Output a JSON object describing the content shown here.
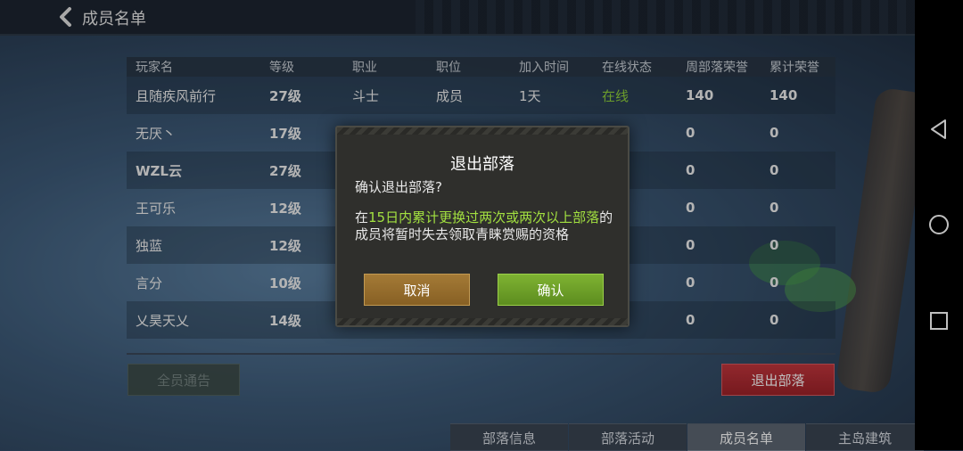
{
  "header": {
    "title": "成员名单"
  },
  "table": {
    "columns": [
      "玩家名",
      "等级",
      "职业",
      "职位",
      "加入时间",
      "在线状态",
      "周部落荣誉",
      "累计荣誉"
    ],
    "rows": [
      {
        "name": "且随疾风前行",
        "level": "27级",
        "class": "斗士",
        "role": "成员",
        "joined": "1天",
        "status": "在线",
        "weekly": "140",
        "total": "140"
      },
      {
        "name": "无厌丶",
        "level": "17级",
        "class": "",
        "role": "",
        "joined": "",
        "status": "",
        "weekly": "0",
        "total": "0"
      },
      {
        "name": "WZL云",
        "level": "27级",
        "class": "",
        "role": "",
        "joined": "",
        "status": "",
        "weekly": "0",
        "total": "0"
      },
      {
        "name": "王可乐",
        "level": "12级",
        "class": "",
        "role": "",
        "joined": "",
        "status": "",
        "weekly": "0",
        "total": "0"
      },
      {
        "name": "独蓝",
        "level": "12级",
        "class": "",
        "role": "",
        "joined": "",
        "status": "",
        "weekly": "0",
        "total": "0"
      },
      {
        "name": "言分",
        "level": "10级",
        "class": "",
        "role": "",
        "joined": "",
        "status": "",
        "weekly": "0",
        "total": "0"
      },
      {
        "name": "乂昊天乂",
        "level": "14级",
        "class": "",
        "role": "",
        "joined": "",
        "status": "",
        "weekly": "0",
        "total": "0"
      }
    ]
  },
  "buttons": {
    "announce_all": "全员通告",
    "exit_tribe": "退出部落"
  },
  "tabs": [
    "部落信息",
    "部落活动",
    "成员名单",
    "主岛建筑"
  ],
  "active_tab": "成员名单",
  "dialog": {
    "title": "退出部落",
    "question": "确认退出部落?",
    "warning_prefix": "在",
    "warning_highlight": "15日内累计更换过两次或两次以上部落",
    "warning_suffix": "的成员将暂时失去领取青睐赏赐的资格",
    "cancel": "取消",
    "confirm": "确认"
  },
  "colors": {
    "online": "#8fd13a",
    "exit_button": "#b02b32",
    "confirm_button": "#6e9f28",
    "cancel_button": "#96702e"
  },
  "icons": {
    "back": "chevron-left-icon",
    "nav_back": "triangle-back-icon",
    "nav_home": "circle-home-icon",
    "nav_recent": "square-recent-icon"
  }
}
